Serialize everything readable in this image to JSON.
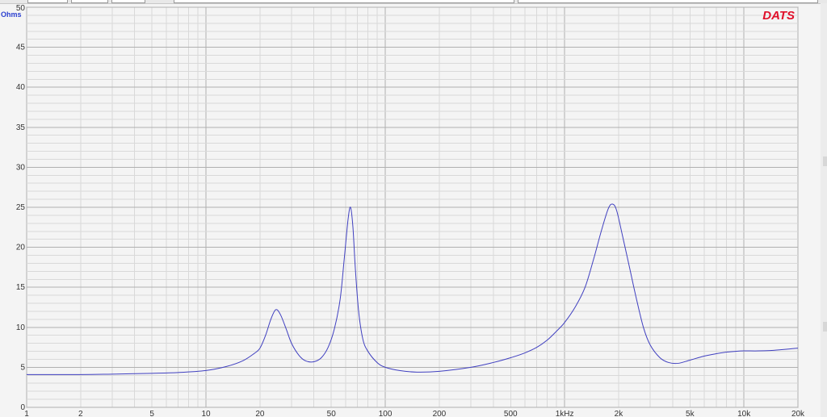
{
  "colors": {
    "curve": "#4040c0",
    "logo": "#e0102a",
    "ylabel": "#2a3fd0",
    "major_grid": "#b0b0b0",
    "minor_grid": "#d9d9d9",
    "plot_bg": "#f4f4f4"
  },
  "logo_text": "DATS",
  "chart_data": {
    "type": "line",
    "title": "",
    "xlabel": "",
    "ylabel": "Ohms",
    "x_scale": "log",
    "xlim": [
      1,
      20000
    ],
    "ylim": [
      0,
      50
    ],
    "grid": true,
    "y_ticks": [
      "0",
      "5",
      "10",
      "15",
      "20",
      "25",
      "30",
      "35",
      "40",
      "45",
      "50"
    ],
    "x_ticks": [
      {
        "value": 1,
        "label": "1"
      },
      {
        "value": 2,
        "label": "2"
      },
      {
        "value": 5,
        "label": "5"
      },
      {
        "value": 10,
        "label": "10"
      },
      {
        "value": 20,
        "label": "20"
      },
      {
        "value": 50,
        "label": "50"
      },
      {
        "value": 100,
        "label": "100"
      },
      {
        "value": 200,
        "label": "200"
      },
      {
        "value": 500,
        "label": "500"
      },
      {
        "value": 1000,
        "label": "1kHz"
      },
      {
        "value": 2000,
        "label": "2k"
      },
      {
        "value": 5000,
        "label": "5k"
      },
      {
        "value": 10000,
        "label": "10k"
      },
      {
        "value": 20000,
        "label": "20k"
      }
    ],
    "series": [
      {
        "points": [
          [
            1,
            4.1
          ],
          [
            2,
            4.1
          ],
          [
            3,
            4.15
          ],
          [
            5,
            4.25
          ],
          [
            7,
            4.35
          ],
          [
            10,
            4.6
          ],
          [
            13,
            5.1
          ],
          [
            16,
            5.8
          ],
          [
            18.5,
            6.7
          ],
          [
            20,
            7.4
          ],
          [
            21.5,
            9.0
          ],
          [
            23,
            11.0
          ],
          [
            24.5,
            12.2
          ],
          [
            26,
            11.6
          ],
          [
            28,
            9.8
          ],
          [
            30,
            8.0
          ],
          [
            33,
            6.5
          ],
          [
            36,
            5.8
          ],
          [
            40,
            5.7
          ],
          [
            44,
            6.2
          ],
          [
            48,
            7.5
          ],
          [
            52,
            9.8
          ],
          [
            56,
            13.5
          ],
          [
            59,
            18.5
          ],
          [
            62,
            23.5
          ],
          [
            64,
            25.0
          ],
          [
            66,
            22.5
          ],
          [
            68,
            17.5
          ],
          [
            71,
            12.0
          ],
          [
            75,
            8.5
          ],
          [
            80,
            7.0
          ],
          [
            90,
            5.6
          ],
          [
            100,
            5.0
          ],
          [
            120,
            4.6
          ],
          [
            150,
            4.4
          ],
          [
            200,
            4.5
          ],
          [
            300,
            5.0
          ],
          [
            400,
            5.6
          ],
          [
            500,
            6.2
          ],
          [
            600,
            6.8
          ],
          [
            700,
            7.5
          ],
          [
            800,
            8.4
          ],
          [
            900,
            9.5
          ],
          [
            1000,
            10.6
          ],
          [
            1150,
            12.6
          ],
          [
            1300,
            15.0
          ],
          [
            1450,
            18.5
          ],
          [
            1600,
            22.0
          ],
          [
            1750,
            24.8
          ],
          [
            1850,
            25.4
          ],
          [
            1950,
            24.6
          ],
          [
            2100,
            21.5
          ],
          [
            2300,
            17.5
          ],
          [
            2500,
            13.8
          ],
          [
            2750,
            10.0
          ],
          [
            3000,
            7.8
          ],
          [
            3400,
            6.2
          ],
          [
            3800,
            5.6
          ],
          [
            4300,
            5.5
          ],
          [
            5000,
            5.9
          ],
          [
            6000,
            6.4
          ],
          [
            7000,
            6.7
          ],
          [
            8000,
            6.9
          ],
          [
            9000,
            7.0
          ],
          [
            10000,
            7.05
          ],
          [
            12000,
            7.05
          ],
          [
            14000,
            7.1
          ],
          [
            16000,
            7.2
          ],
          [
            18000,
            7.3
          ],
          [
            20000,
            7.4
          ]
        ]
      }
    ]
  }
}
